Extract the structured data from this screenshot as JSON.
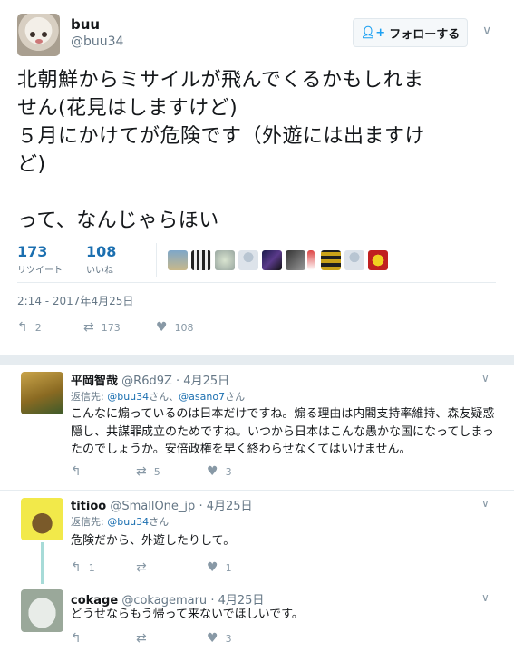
{
  "tweet": {
    "name": "buu",
    "handle": "@buu34",
    "follow_label": "フォローする",
    "follow_icon": "person-plus-icon",
    "text_lines": [
      "北朝鮮からミサイルが飛んでくるかもしれま",
      "せん(花見はしますけど)",
      "５月にかけてが危険です（外遊には出ますけ",
      "ど)",
      "",
      "って、なんじゃらほい"
    ],
    "retweets_count": "173",
    "retweets_label": "リツイート",
    "likes_count": "108",
    "likes_label": "いいね",
    "timestamp": "2:14 - 2017年4月25日",
    "actions": {
      "reply": "2",
      "retweet": "173",
      "like": "108"
    }
  },
  "replies": [
    {
      "name": "平岡智哉",
      "handle": "@R6d9Z",
      "time": "· 4月25日",
      "reply_to_label": "返信先:",
      "reply_to_users": [
        "@buu34",
        "@asano7"
      ],
      "reply_to_suffix": "さん、",
      "reply_to_suffix2": "さん",
      "body_lines": [
        "こんなに煽っているのは日本だけですね。煽る理由は内閣支持率維持、森友疑惑",
        "隠し、共謀罪成立のためですね。いつから日本はこんな愚かな国になってしまっ",
        "たのでしょうか。安倍政権を早く終わらせなくてはいけません。"
      ],
      "actions": {
        "reply": "",
        "retweet": "5",
        "like": "3"
      }
    },
    {
      "name": "titioo",
      "handle": "@SmallOne_jp",
      "time": "· 4月25日",
      "reply_to_label": "返信先:",
      "reply_to_users": [
        "@buu34"
      ],
      "reply_to_suffix": "さん",
      "body_lines": [
        "危険だから、外遊したりして。"
      ],
      "actions": {
        "reply": "1",
        "retweet": "",
        "like": "1"
      }
    },
    {
      "name": "cokage",
      "handle": "@cokagemaru",
      "time": "· 4月25日",
      "body_lines": [
        "どうせならもう帰って来ないでほしいです。"
      ],
      "actions": {
        "reply": "",
        "retweet": "",
        "like": "3"
      }
    }
  ],
  "colors": {
    "link": "#1b6fb0",
    "muted": "#657786",
    "icon": "#8899a6",
    "thread": "#a7dbd8"
  }
}
